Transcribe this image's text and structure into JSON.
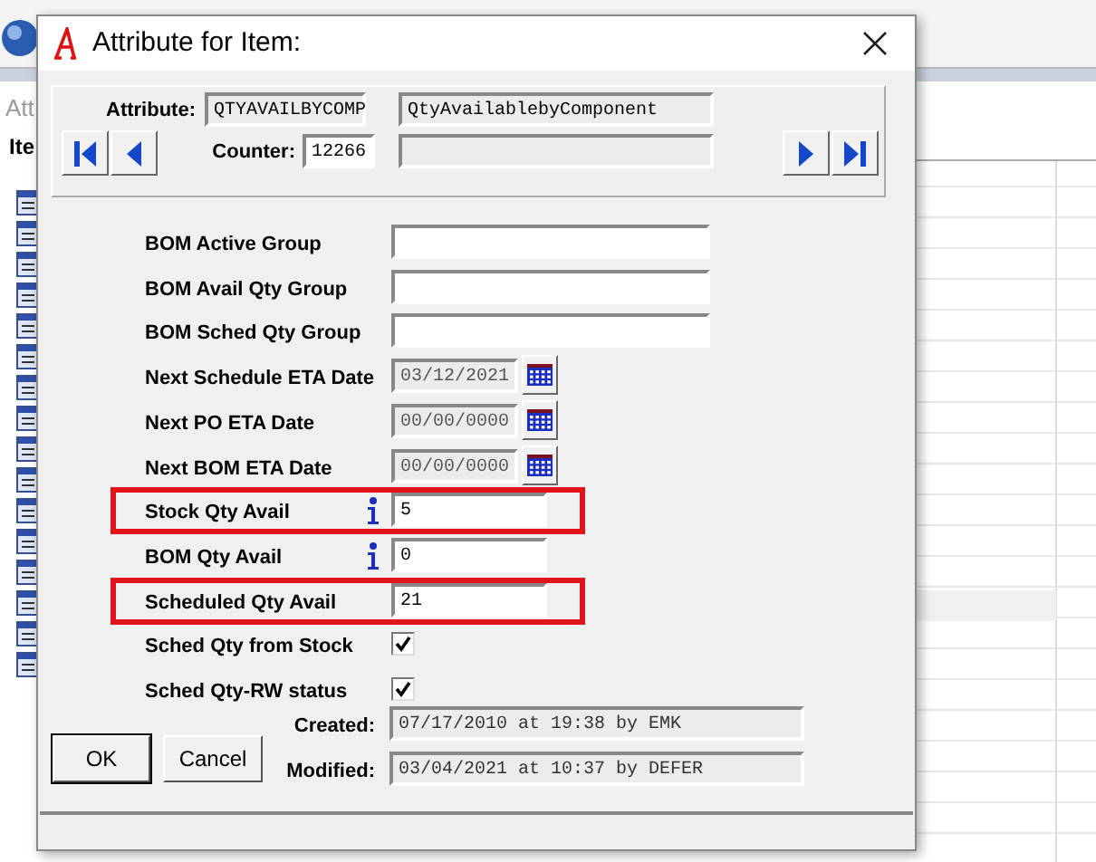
{
  "background": {
    "fragments": [
      "Att",
      "Ite"
    ]
  },
  "window": {
    "title": "Attribute for Item:"
  },
  "header": {
    "attribute_label": "Attribute:",
    "attribute_code": "QTYAVAILBYCOMP",
    "attribute_name": "QtyAvailablebyComponent",
    "counter_label": "Counter:",
    "counter": "12266"
  },
  "fields": [
    {
      "kind": "text",
      "label": "BOM Active Group",
      "info": false,
      "highlighted": false
    },
    {
      "kind": "text",
      "label": "BOM Avail Qty Group",
      "info": false,
      "highlighted": false
    },
    {
      "kind": "text",
      "label": "BOM Sched Qty Group",
      "info": false,
      "highlighted": false
    },
    {
      "kind": "date",
      "label": "Next Schedule ETA Date",
      "value": "03/12/2021",
      "info": false,
      "highlighted": false
    },
    {
      "kind": "date",
      "label": "Next PO ETA Date",
      "value": "00/00/0000",
      "info": false,
      "highlighted": false
    },
    {
      "kind": "date",
      "label": "Next BOM ETA Date",
      "value": "00/00/0000",
      "info": false,
      "highlighted": false
    },
    {
      "kind": "number",
      "label": "Stock Qty Avail",
      "value": "5",
      "info": true,
      "highlighted": true
    },
    {
      "kind": "number",
      "label": "BOM Qty Avail",
      "value": "0",
      "info": true,
      "highlighted": false
    },
    {
      "kind": "number",
      "label": "Scheduled Qty Avail",
      "value": "21",
      "info": false,
      "highlighted": true
    },
    {
      "kind": "checkbox",
      "label": "Sched Qty from Stock",
      "checked": true,
      "info": false,
      "highlighted": false
    },
    {
      "kind": "checkbox",
      "label": "Sched Qty-RW status",
      "checked": true,
      "info": false,
      "highlighted": false
    }
  ],
  "buttons": [
    {
      "label": "OK",
      "default": true
    },
    {
      "label": "Cancel",
      "default": false
    }
  ],
  "audit": [
    {
      "label": "Created:",
      "value": "07/17/2010 at 19:38 by EMK"
    },
    {
      "label": "Modified:",
      "value": "03/04/2021 at 10:37 by DEFER"
    }
  ]
}
